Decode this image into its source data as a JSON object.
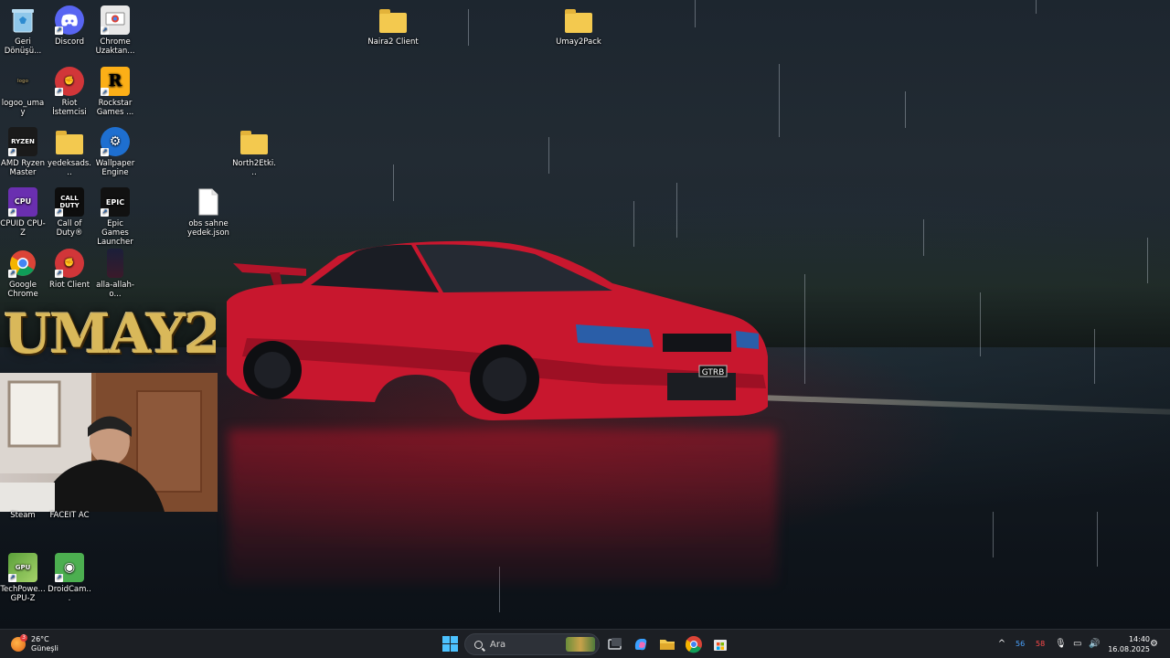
{
  "desktop": {
    "icons": [
      {
        "label": "Geri Dönüşü...",
        "icon": "recycle-bin-icon"
      },
      {
        "label": "Discord",
        "icon": "discord-icon"
      },
      {
        "label": "Chrome Uzaktan...",
        "icon": "chrome-remote-desktop-icon"
      },
      {
        "label": "Naira2 Client",
        "icon": "folder-icon"
      },
      {
        "label": "Umay2Pack",
        "icon": "folder-icon"
      },
      {
        "label": "logoo_umay",
        "icon": "image-file-icon"
      },
      {
        "label": "Riot İstemcisi",
        "icon": "riot-client-icon"
      },
      {
        "label": "Rockstar Games ...",
        "icon": "rockstar-games-icon"
      },
      {
        "label": "AMD Ryzen Master",
        "icon": "amd-ryzen-master-icon"
      },
      {
        "label": "yedeksads...",
        "icon": "folder-icon"
      },
      {
        "label": "Wallpaper Engine",
        "icon": "wallpaper-engine-icon"
      },
      {
        "label": "North2Etki...",
        "icon": "folder-icon"
      },
      {
        "label": "CPUID CPU-Z",
        "icon": "cpu-z-icon"
      },
      {
        "label": "Call of Duty®",
        "icon": "call-of-duty-icon"
      },
      {
        "label": "Epic Games Launcher",
        "icon": "epic-games-icon"
      },
      {
        "label": "obs sahne yedek.json",
        "icon": "json-file-icon"
      },
      {
        "label": "Google Chrome",
        "icon": "chrome-icon"
      },
      {
        "label": "Riot Client",
        "icon": "riot-client-icon"
      },
      {
        "label": "alla-allah-o...",
        "icon": "image-file-icon"
      },
      {
        "label": "Steam",
        "icon": "steam-icon"
      },
      {
        "label": "FACEIT AC",
        "icon": "faceit-icon"
      },
      {
        "label": "TechPowe... GPU-Z",
        "icon": "gpu-z-icon"
      },
      {
        "label": "DroidCam...",
        "icon": "droidcam-icon"
      }
    ],
    "overlay_logo_text": "UMAY2",
    "car_plate": "GTRB"
  },
  "taskbar": {
    "weather": {
      "temp": "26°C",
      "condition": "Güneşli",
      "badge": "3"
    },
    "search_placeholder": "Ara",
    "pinned": [
      "task-view",
      "copilot",
      "file-explorer",
      "chrome",
      "microsoft-store"
    ],
    "tray": {
      "blue_value": "56",
      "red_value": "58"
    },
    "clock": {
      "time": "14:40",
      "date": "16.08.2025"
    }
  },
  "colors": {
    "taskbar_bg": "#1c1f24",
    "accent": "#4cc2ff",
    "folder": "#f3c94f",
    "car_red": "#c8172e"
  }
}
